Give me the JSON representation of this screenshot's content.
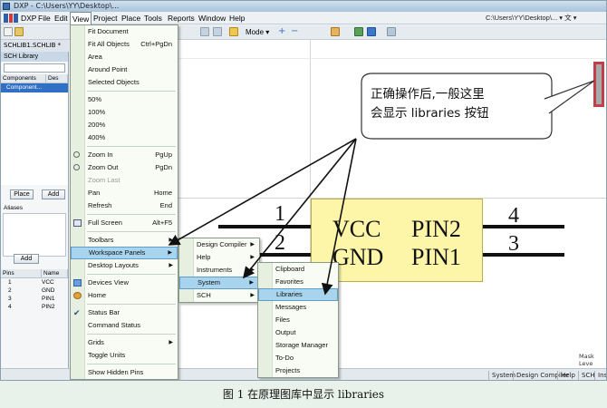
{
  "window": {
    "title": "DXP - C:\\Users\\YY\\Desktop\\...",
    "path": "C:\\Users\\YY\\Desktop\\...  ▾  文 ▾"
  },
  "menubar": {
    "app": "DXP",
    "file": "File",
    "edit": "Edit",
    "view": "View",
    "project": "Project",
    "place": "Place",
    "tools": "Tools",
    "reports": "Reports",
    "window": "Window",
    "help": "Help"
  },
  "toolbar": {
    "mode": "Mode ▾"
  },
  "left_panel": {
    "doc_tab": "SCHLIB1.SCHLIB *",
    "title": "SCH Library",
    "components_header": "Components",
    "description_header": "Des",
    "selected_component": "Component...",
    "place_button": "Place",
    "add_button": "Add",
    "aliases_label": "Aliases",
    "add_alias_button": "Add",
    "pins_header": "Pins",
    "name_header": "Name",
    "pins": [
      {
        "num": "1",
        "name": "VCC"
      },
      {
        "num": "2",
        "name": "GND"
      },
      {
        "num": "3",
        "name": "PIN1"
      },
      {
        "num": "4",
        "name": "PIN2"
      }
    ]
  },
  "view_menu": [
    {
      "label": "Fit Document",
      "accel": ""
    },
    {
      "label": "Fit All Objects",
      "accel": "Ctrl+PgDn"
    },
    {
      "label": "Area",
      "accel": ""
    },
    {
      "label": "Around Point",
      "accel": ""
    },
    {
      "label": "Selected Objects",
      "accel": ""
    },
    {
      "label": "50%",
      "accel": ""
    },
    {
      "label": "100%",
      "accel": ""
    },
    {
      "label": "200%",
      "accel": ""
    },
    {
      "label": "400%",
      "accel": ""
    },
    {
      "label": "Zoom In",
      "accel": "PgUp"
    },
    {
      "label": "Zoom Out",
      "accel": "PgDn"
    },
    {
      "label": "Zoom Last",
      "accel": ""
    },
    {
      "label": "Pan",
      "accel": "Home"
    },
    {
      "label": "Refresh",
      "accel": "End"
    },
    {
      "label": "Full Screen",
      "accel": "Alt+F5"
    },
    {
      "label": "Toolbars",
      "accel": ""
    },
    {
      "label": "Workspace Panels",
      "accel": ""
    },
    {
      "label": "Desktop Layouts",
      "accel": ""
    },
    {
      "label": "Devices View",
      "accel": ""
    },
    {
      "label": "Home",
      "accel": ""
    },
    {
      "label": "Status Bar",
      "accel": ""
    },
    {
      "label": "Command Status",
      "accel": ""
    },
    {
      "label": "Grids",
      "accel": ""
    },
    {
      "label": "Toggle Units",
      "accel": ""
    },
    {
      "label": "Show Hidden Pins",
      "accel": ""
    }
  ],
  "workspace_menu": [
    "Design Compiler",
    "Help",
    "Instruments",
    "System",
    "SCH"
  ],
  "system_menu": [
    "Clipboard",
    "Favorites",
    "Libraries",
    "Messages",
    "Files",
    "Output",
    "Storage Manager",
    "To-Do",
    "Projects"
  ],
  "symbol": {
    "left_labels": [
      "VCC",
      "GND"
    ],
    "right_labels": [
      "PIN2",
      "PIN1"
    ],
    "left_pins": [
      "1",
      "2"
    ],
    "right_pins": [
      "4",
      "3"
    ]
  },
  "callout": {
    "line1": "正确操作后,一般这里",
    "line2": "会显示 libraries 按钮"
  },
  "statusbar": {
    "tabs": [
      "System",
      "Design Compiler",
      "Help",
      "SCH",
      "Ins"
    ],
    "mask": "Mask Leve"
  },
  "caption": "图 1 在原理图库中显示 libraries",
  "colors": {
    "menu_bg": "#f8fcf4",
    "highlight": "#a8d4ee",
    "component_fill": "#fdf6a8",
    "accent_red": "#c0404a"
  }
}
